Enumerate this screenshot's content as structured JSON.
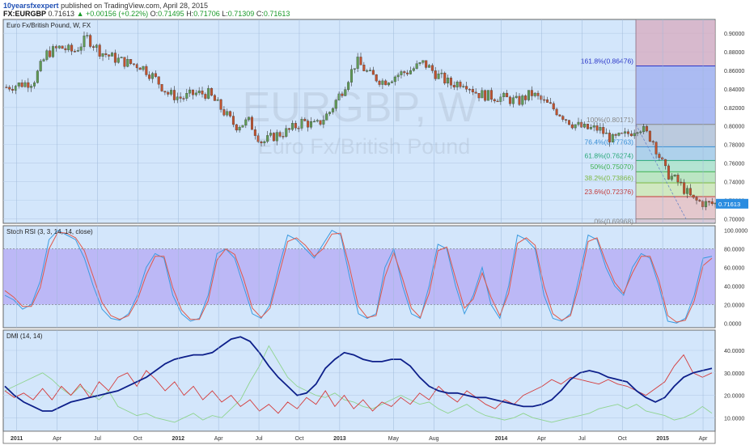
{
  "header": {
    "publisher": "10yearsfxexpert",
    "published_text": "published on TradingView.com, April 28, 2015",
    "symbol": "FX:EURGBP",
    "last": "0.71613",
    "change": "+0.00156 (+0.22%)",
    "open_label": "O:",
    "open": "0.71495",
    "high_label": "H:",
    "high": "0.71706",
    "low_label": "L:",
    "low": "0.71309",
    "close_label": "C:",
    "close": "0.71613"
  },
  "watermark": {
    "symbol": "EURGBP, W",
    "name": "Euro Fx/British Pound"
  },
  "colors": {
    "background": "#d3e6fb",
    "up_candle": "#5f9a55",
    "down_candle": "#c0522e",
    "rsi_k": "#3b9be0",
    "rsi_d": "#e0584a",
    "rsi_band": "#b4a8f4",
    "dmi_adx": "#0d1f8a",
    "dmi_plus": "#d43a3a",
    "dmi_minus": "#8fd48f",
    "last_price_badge": "#2a8ce0"
  },
  "chart_data": [
    {
      "type": "candlestick",
      "title": "Euro Fx/British Pound, W, FX",
      "ylim": [
        0.695,
        0.915
      ],
      "y_ticks": [
        "0.90000",
        "0.88000",
        "0.86000",
        "0.84000",
        "0.82000",
        "0.80000",
        "0.78000",
        "0.76000",
        "0.74000",
        "0.72000",
        "0.70000"
      ],
      "last_price": "0.71613",
      "price_path": {
        "start": "2010-12",
        "end": "2015-04",
        "anchors": [
          [
            "2010-12",
            0.842
          ],
          [
            "2011-02",
            0.848
          ],
          [
            "2011-03",
            0.878
          ],
          [
            "2011-04",
            0.885
          ],
          [
            "2011-05",
            0.88
          ],
          [
            "2011-06",
            0.895
          ],
          [
            "2011-07",
            0.88
          ],
          [
            "2011-08",
            0.873
          ],
          [
            "2011-09",
            0.868
          ],
          [
            "2011-10",
            0.865
          ],
          [
            "2011-11",
            0.852
          ],
          [
            "2011-12",
            0.835
          ],
          [
            "2012-01",
            0.83
          ],
          [
            "2012-02",
            0.835
          ],
          [
            "2012-03",
            0.835
          ],
          [
            "2012-04",
            0.818
          ],
          [
            "2012-05",
            0.8
          ],
          [
            "2012-06",
            0.805
          ],
          [
            "2012-07",
            0.782
          ],
          [
            "2012-08",
            0.79
          ],
          [
            "2012-09",
            0.795
          ],
          [
            "2012-10",
            0.805
          ],
          [
            "2012-11",
            0.8
          ],
          [
            "2012-12",
            0.815
          ],
          [
            "2013-01",
            0.84
          ],
          [
            "2013-02",
            0.87
          ],
          [
            "2013-03",
            0.855
          ],
          [
            "2013-04",
            0.848
          ],
          [
            "2013-05",
            0.855
          ],
          [
            "2013-06",
            0.86
          ],
          [
            "2013-07",
            0.868
          ],
          [
            "2013-08",
            0.855
          ],
          [
            "2013-09",
            0.845
          ],
          [
            "2013-10",
            0.848
          ],
          [
            "2013-11",
            0.835
          ],
          [
            "2013-12",
            0.832
          ],
          [
            "2014-01",
            0.83
          ],
          [
            "2014-02",
            0.826
          ],
          [
            "2014-03",
            0.835
          ],
          [
            "2014-04",
            0.825
          ],
          [
            "2014-05",
            0.815
          ],
          [
            "2014-06",
            0.803
          ],
          [
            "2014-07",
            0.797
          ],
          [
            "2014-08",
            0.797
          ],
          [
            "2014-09",
            0.785
          ],
          [
            "2014-10",
            0.79
          ],
          [
            "2014-11",
            0.8
          ],
          [
            "2014-12",
            0.785
          ],
          [
            "2015-01",
            0.75
          ],
          [
            "2015-02",
            0.738
          ],
          [
            "2015-03",
            0.72
          ],
          [
            "2015-04",
            0.716
          ]
        ]
      },
      "fibonacci": [
        {
          "label": "161.8%(0.86476)",
          "value": 0.86476,
          "color": "#2b36c8",
          "fill": "#a3b3f0"
        },
        {
          "label": "100%(0.80171)",
          "value": 0.80171,
          "color": "#888888",
          "fill": "#b6c4d8"
        },
        {
          "label": "76.4%(0.77763)",
          "value": 0.77763,
          "color": "#3a8fd4",
          "fill": "#a7cde8"
        },
        {
          "label": "61.8%(0.76274)",
          "value": 0.76274,
          "color": "#29a879",
          "fill": "#aee3cb"
        },
        {
          "label": "50%(0.75070)",
          "value": 0.7507,
          "color": "#3cb050",
          "fill": "#b6e4b8"
        },
        {
          "label": "38.2%(0.73866)",
          "value": 0.73866,
          "color": "#7cb842",
          "fill": "#cfe8b5"
        },
        {
          "label": "23.6%(0.72376)",
          "value": 0.72376,
          "color": "#c43a3a",
          "fill": "#e6c2c4"
        },
        {
          "label": "0%(0.69968)",
          "value": 0.69968,
          "color": "#888888",
          "fill": "#d8c6d2"
        }
      ]
    },
    {
      "type": "line",
      "title": "Stoch RSI (3, 3, 14, 14, close)",
      "ylim": [
        -5,
        105
      ],
      "band": [
        20,
        80
      ],
      "y_ticks": [
        "100.0000",
        "80.0000",
        "60.0000",
        "40.0000",
        "20.0000",
        "0.0000"
      ],
      "series": [
        {
          "values": [
            30,
            25,
            15,
            20,
            45,
            90,
            100,
            95,
            90,
            70,
            40,
            15,
            5,
            3,
            10,
            30,
            60,
            75,
            70,
            30,
            10,
            2,
            5,
            30,
            75,
            80,
            70,
            40,
            10,
            5,
            20,
            60,
            95,
            90,
            80,
            70,
            85,
            100,
            95,
            50,
            10,
            5,
            10,
            60,
            80,
            40,
            10,
            5,
            40,
            85,
            80,
            40,
            10,
            30,
            60,
            20,
            5,
            40,
            95,
            90,
            80,
            30,
            5,
            2,
            10,
            50,
            95,
            90,
            60,
            40,
            30,
            60,
            75,
            70,
            40,
            2,
            0,
            5,
            30,
            70,
            72
          ]
        },
        {
          "values": [
            35,
            28,
            18,
            18,
            38,
            80,
            98,
            97,
            92,
            78,
            50,
            22,
            8,
            4,
            8,
            25,
            52,
            72,
            72,
            38,
            14,
            4,
            4,
            24,
            68,
            80,
            74,
            48,
            16,
            6,
            16,
            52,
            88,
            92,
            84,
            72,
            80,
            96,
            97,
            60,
            18,
            6,
            8,
            50,
            76,
            48,
            16,
            6,
            32,
            78,
            82,
            48,
            16,
            26,
            54,
            28,
            8,
            32,
            86,
            92,
            84,
            40,
            10,
            3,
            8,
            42,
            88,
            92,
            66,
            44,
            32,
            54,
            72,
            72,
            46,
            8,
            1,
            3,
            24,
            62,
            70
          ]
        }
      ]
    },
    {
      "type": "line",
      "title": "DMI (14, 14)",
      "ylim": [
        4,
        49
      ],
      "y_ticks": [
        "40.0000",
        "30.0000",
        "20.0000",
        "10.0000"
      ],
      "series": [
        {
          "values": [
            24,
            20,
            17,
            15,
            13,
            13,
            15,
            17,
            18,
            19,
            20,
            21,
            22,
            24,
            26,
            28,
            31,
            34,
            36,
            37,
            38,
            38,
            39,
            42,
            45,
            46,
            44,
            39,
            33,
            28,
            24,
            20,
            21,
            25,
            32,
            36,
            39,
            38,
            36,
            35,
            35,
            36,
            36,
            33,
            28,
            24,
            22,
            21,
            21,
            20,
            19,
            19,
            18,
            17,
            16,
            15,
            15,
            16,
            18,
            22,
            27,
            30,
            31,
            30,
            28,
            27,
            26,
            22,
            19,
            17,
            19,
            24,
            28,
            30,
            31,
            32
          ]
        },
        {
          "values": [
            22,
            19,
            21,
            18,
            23,
            18,
            24,
            20,
            25,
            19,
            26,
            22,
            28,
            30,
            24,
            31,
            27,
            22,
            26,
            20,
            24,
            18,
            22,
            17,
            20,
            15,
            18,
            13,
            16,
            12,
            17,
            14,
            19,
            16,
            22,
            15,
            20,
            14,
            18,
            13,
            17,
            15,
            19,
            16,
            21,
            18,
            24,
            20,
            17,
            22,
            19,
            16,
            14,
            18,
            16,
            20,
            22,
            24,
            27,
            25,
            28,
            27,
            26,
            25,
            27,
            25,
            24,
            22,
            20,
            23,
            26,
            33,
            38,
            30,
            28,
            30
          ]
        },
        {
          "values": [
            22,
            24,
            26,
            28,
            30,
            27,
            23,
            20,
            24,
            21,
            18,
            22,
            15,
            13,
            11,
            12,
            10,
            9,
            8,
            10,
            12,
            9,
            11,
            10,
            14,
            18,
            26,
            33,
            42,
            35,
            28,
            24,
            22,
            20,
            19,
            21,
            18,
            17,
            15,
            14,
            16,
            18,
            20,
            18,
            16,
            17,
            14,
            12,
            14,
            16,
            13,
            11,
            10,
            9,
            10,
            12,
            10,
            9,
            8,
            9,
            10,
            11,
            12,
            14,
            15,
            16,
            14,
            16,
            13,
            12,
            11,
            9,
            10,
            12,
            15,
            12
          ]
        }
      ]
    }
  ],
  "x_axis": {
    "ticks": [
      "2011",
      "Apr",
      "Jul",
      "Oct",
      "2012",
      "Apr",
      "Jul",
      "Oct",
      "2013",
      "May",
      "Aug",
      "2014",
      "Apr",
      "Jul",
      "Oct",
      "2015",
      "Apr"
    ]
  }
}
